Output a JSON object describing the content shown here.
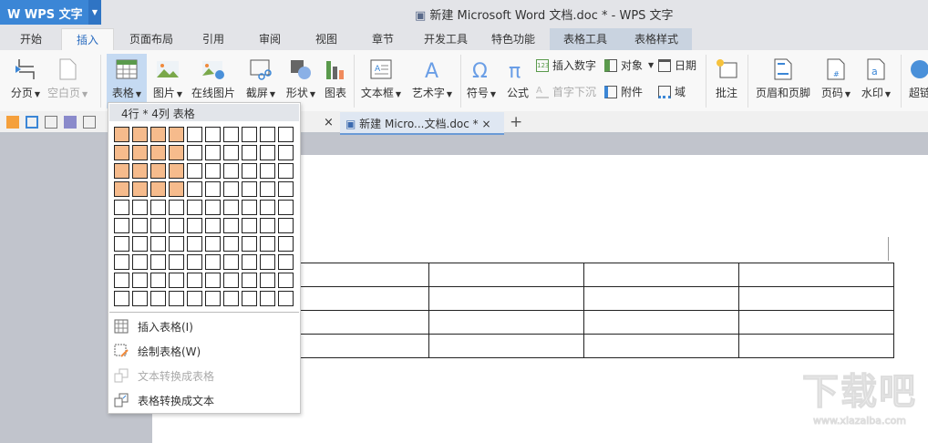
{
  "app": {
    "name": "WPS 文字",
    "title": "新建 Microsoft Word 文档.doc * - WPS 文字"
  },
  "tabs": [
    "开始",
    "插入",
    "页面布局",
    "引用",
    "审阅",
    "视图",
    "章节",
    "开发工具",
    "特色功能",
    "表格工具",
    "表格样式"
  ],
  "active_tab": "插入",
  "ribbon": {
    "big": [
      "分页",
      "空白页",
      "表格",
      "图片",
      "在线图片",
      "截屏",
      "形状",
      "图表",
      "文本框",
      "艺术字",
      "符号",
      "公式",
      "批注",
      "页眉和页脚",
      "页码",
      "水印",
      "超链"
    ],
    "small": [
      "插入数字",
      "首字下沉",
      "对象",
      "附件",
      "日期",
      "域"
    ]
  },
  "doc_tab": {
    "label": "新建 Micro...文档.doc *",
    "close": "×",
    "new": "+",
    "prev_close": "×"
  },
  "table_menu": {
    "header": "4行 * 4列 表格",
    "grid_rows": 10,
    "grid_cols": 10,
    "selected_rows": 4,
    "selected_cols": 4,
    "highlight_color": "#f6bb8c",
    "items": [
      {
        "label": "插入表格(I)",
        "enabled": true
      },
      {
        "label": "绘制表格(W)",
        "enabled": true
      },
      {
        "label": "文本转换成表格",
        "enabled": false
      },
      {
        "label": "表格转换成文本",
        "enabled": true
      }
    ]
  },
  "watermark": {
    "text": "下载吧",
    "url": "www.xiazaiba.com"
  }
}
